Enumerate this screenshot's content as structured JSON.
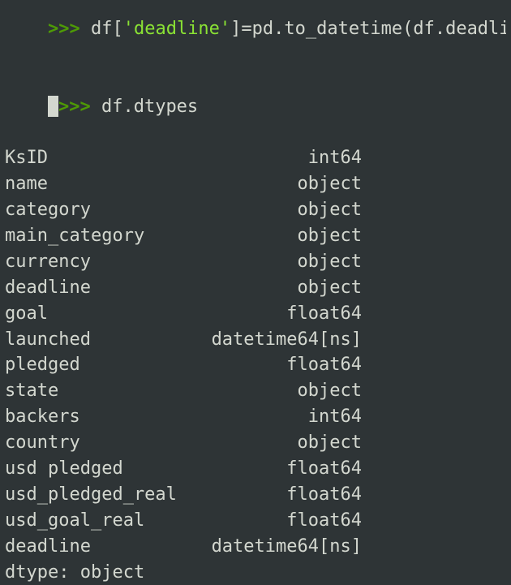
{
  "partial_line": {
    "prompt": ">>> ",
    "before": "df[",
    "highlight": "'deadline'",
    "after": "]=pd.to_datetime(df.deadli"
  },
  "command": {
    "prompt": ">>> ",
    "code": "df.dtypes"
  },
  "rows": [
    {
      "name": "KsID",
      "type": "int64"
    },
    {
      "name": "name",
      "type": "object"
    },
    {
      "name": "category",
      "type": "object"
    },
    {
      "name": "main_category",
      "type": "object"
    },
    {
      "name": "currency",
      "type": "object"
    },
    {
      "name": "deadline",
      "type": "object"
    },
    {
      "name": "goal",
      "type": "float64"
    },
    {
      "name": "launched",
      "type": "datetime64[ns]"
    },
    {
      "name": "pledged",
      "type": "float64"
    },
    {
      "name": "state",
      "type": "object"
    },
    {
      "name": "backers",
      "type": "int64"
    },
    {
      "name": "country",
      "type": "object"
    },
    {
      "name": "usd pledged",
      "type": "float64"
    },
    {
      "name": "usd_pledged_real",
      "type": "float64"
    },
    {
      "name": "usd_goal_real",
      "type": "float64"
    },
    {
      "name": "deadline",
      "type": "datetime64[ns]"
    }
  ],
  "footer": "dtype: object"
}
